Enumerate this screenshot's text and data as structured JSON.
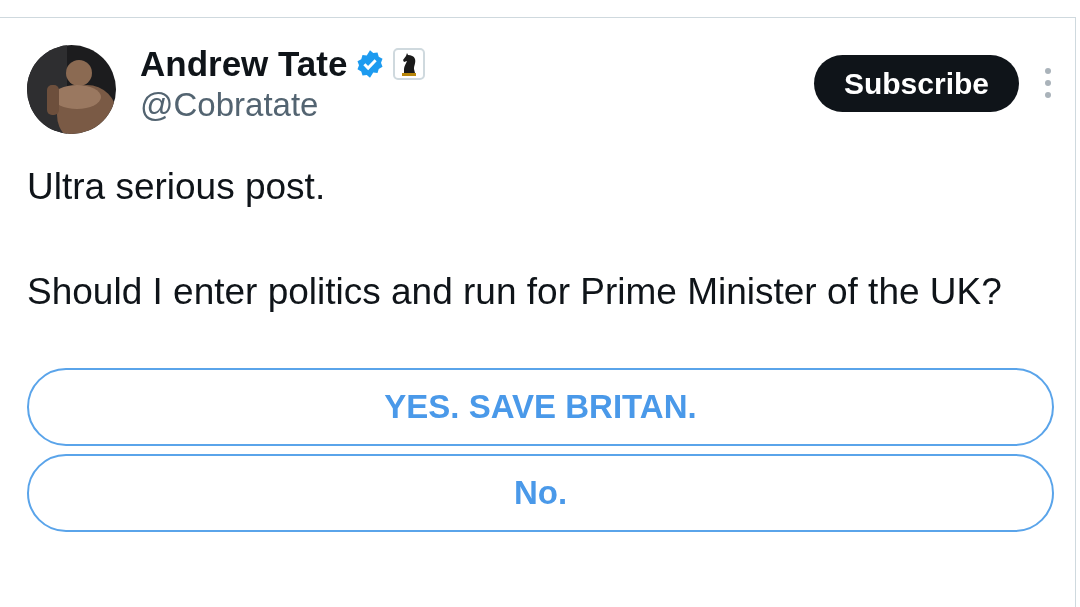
{
  "author": {
    "name": "Andrew Tate",
    "handle": "@Cobratate",
    "verified": true,
    "affiliate_badge": true
  },
  "subscribe_button": {
    "label": "Subscribe"
  },
  "post": {
    "paragraphs": [
      "Ultra serious post.",
      "Should I enter politics and run for Prime Minister of the UK?"
    ]
  },
  "poll": {
    "options": [
      {
        "label": "YES. SAVE BRITAN."
      },
      {
        "label": "No."
      }
    ]
  }
}
